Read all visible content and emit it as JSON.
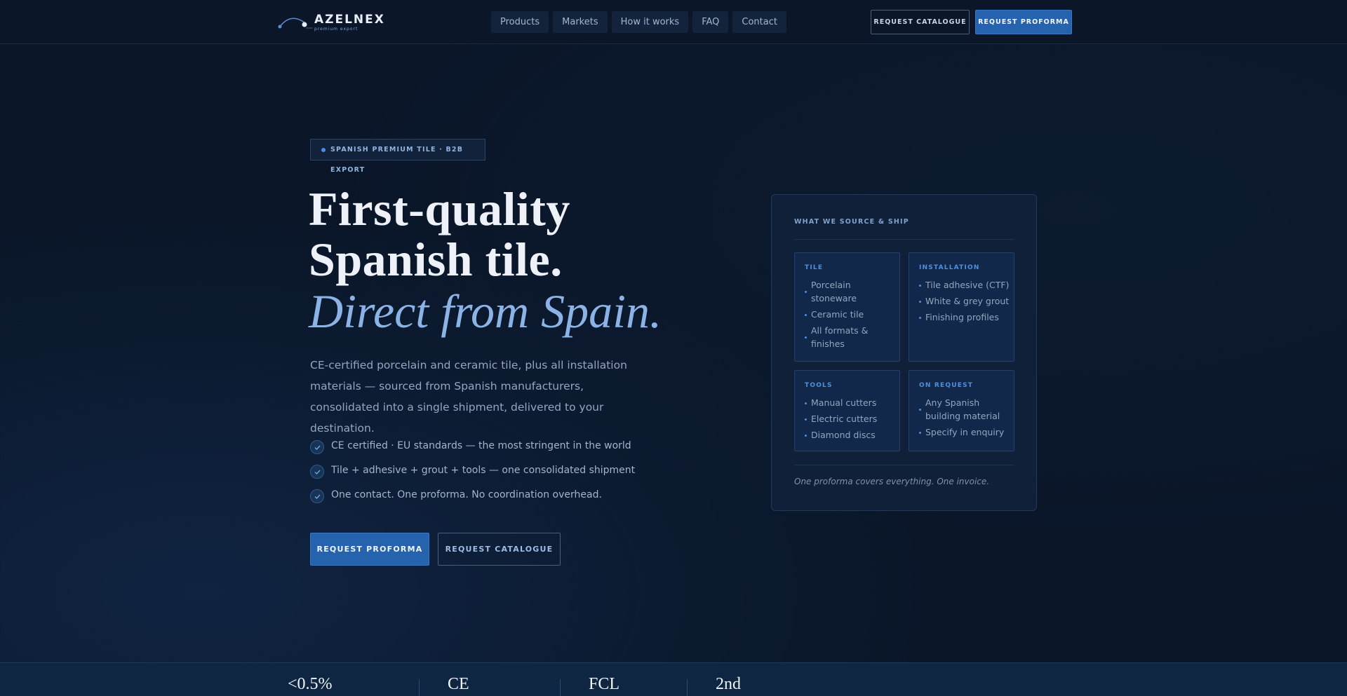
{
  "brand": {
    "name": "AZELNEX",
    "tagline": "premium export"
  },
  "nav": {
    "links": [
      "Products",
      "Markets",
      "How it works",
      "FAQ",
      "Contact"
    ],
    "catalogue_label": "REQUEST CATALOGUE",
    "proforma_label": "REQUEST PROFORMA"
  },
  "hero": {
    "badge": "SPANISH PREMIUM TILE · B2B EXPORT",
    "title": "First-quality Spanish tile.",
    "title_italic": "Direct from Spain.",
    "lead": "CE-certified porcelain and ceramic tile, plus all installation materials — sourced from Spanish manufacturers, consolidated into a single shipment, delivered to your destination.",
    "checks": [
      "CE certified · EU standards — the most stringent in the world",
      "Tile + adhesive + grout + tools — one consolidated shipment",
      "One contact. One proforma. No coordination overhead."
    ],
    "cta_primary": "REQUEST PROFORMA",
    "cta_secondary": "REQUEST CATALOGUE"
  },
  "card": {
    "heading": "WHAT WE SOURCE & SHIP",
    "categories": [
      {
        "title": "TILE",
        "items": [
          "Porcelain stoneware",
          "Ceramic tile",
          "All formats & finishes"
        ]
      },
      {
        "title": "INSTALLATION",
        "items": [
          "Tile adhesive (CTF)",
          "White & grey grout",
          "Finishing profiles"
        ]
      },
      {
        "title": "TOOLS",
        "items": [
          "Manual cutters",
          "Electric cutters",
          "Diamond discs"
        ]
      },
      {
        "title": "ON REQUEST",
        "items": [
          "Any Spanish building material",
          "Specify in enquiry"
        ]
      }
    ],
    "footer": "One proforma covers everything. One invoice."
  },
  "stats": [
    "<0.5%",
    "CE",
    "FCL",
    "2nd"
  ],
  "colors": {
    "background": "#0a1628",
    "accent": "#2663ae",
    "accent_light": "#8cb3e6",
    "category_title": "#4f8fe0"
  }
}
